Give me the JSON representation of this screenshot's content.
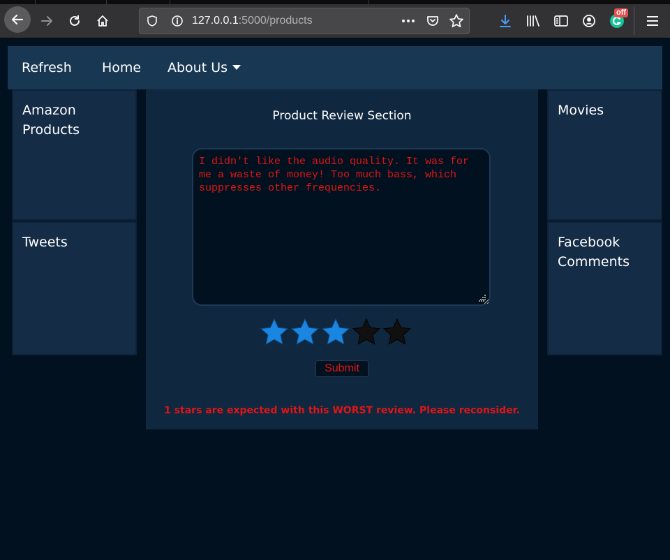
{
  "browser": {
    "url_host": "127.0.0.1",
    "url_path": ":5000/products",
    "extension_badge": "off",
    "icons": [
      "back-arrow-icon",
      "forward-arrow-icon",
      "reload-icon",
      "home-icon",
      "shield-icon",
      "info-icon",
      "more-icon",
      "pocket-icon",
      "star-icon",
      "download-icon",
      "library-icon",
      "sidebar-icon",
      "account-icon",
      "grammarly-icon",
      "menu-icon"
    ]
  },
  "nav": {
    "refresh": "Refresh",
    "home": "Home",
    "about": "About Us"
  },
  "side": {
    "amazon": "Amazon Products",
    "tweets": "Tweets",
    "movies": "Movies",
    "facebook": "Facebook Comments"
  },
  "review": {
    "title": "Product Review Section",
    "text": "I didn't like the audio quality. It was for me a waste of money! Too much bass, which suppresses other frequencies.",
    "rating": 3,
    "max_rating": 5,
    "submit": "Submit",
    "warning": "1 stars are expected with this WORST review. Please reconsider."
  },
  "colors": {
    "accent_star": "#1a86e2",
    "empty_star": "#101010",
    "warning": "#e01515",
    "navbar": "#183753",
    "panel": "#142c45"
  }
}
